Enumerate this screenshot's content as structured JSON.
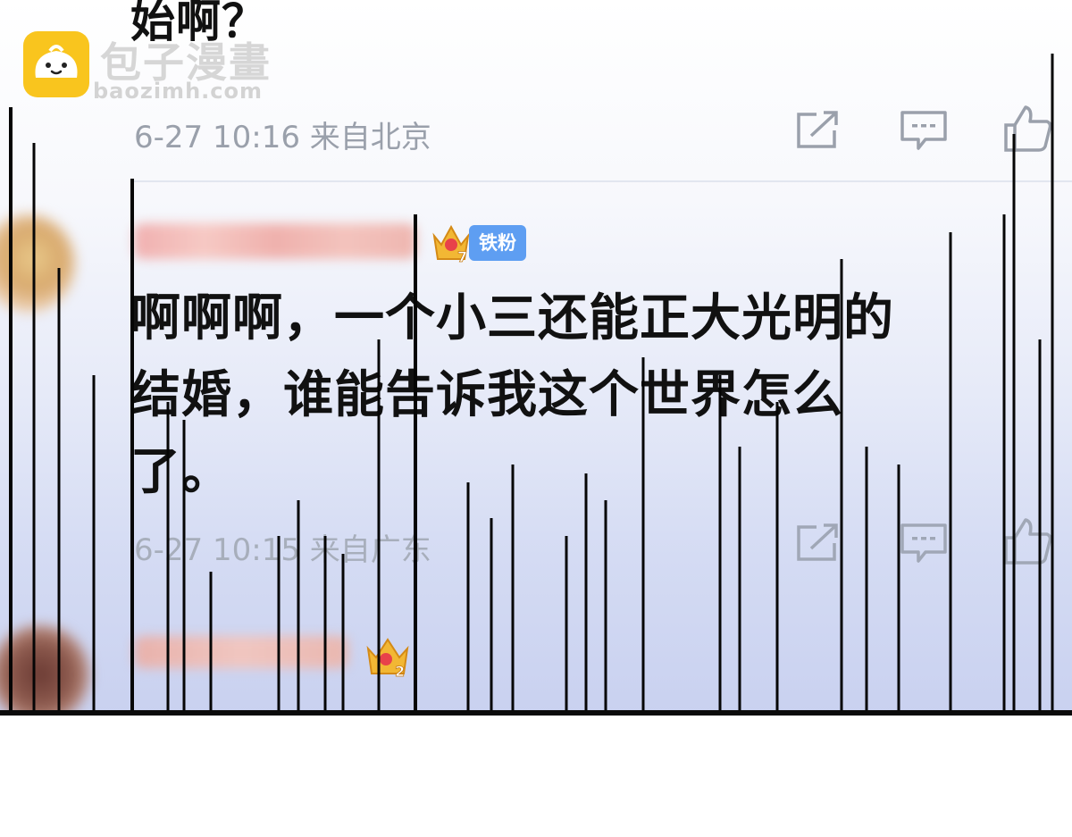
{
  "top_text": "始啊？",
  "watermark": {
    "site_name": "包子漫畫",
    "url": "baozimh.com"
  },
  "post": {
    "meta": "6-27 10:16 来自北京"
  },
  "reply": {
    "badge_level": "7",
    "badge_label": "铁粉",
    "comment": "啊啊啊，一个小三还能正大光明的结婚，谁能告诉我这个世界怎么了。",
    "meta": "6-27 10:15 来自广东"
  },
  "next_reply": {
    "badge_level": "2"
  },
  "icons": [
    "share-icon",
    "comment-icon",
    "like-icon"
  ],
  "colors": {
    "badge_blue": "#5e9ef2",
    "logo_yellow": "#f9c51e",
    "crown_gold": "#f2b734",
    "meta_gray": "#9aa0ab"
  }
}
